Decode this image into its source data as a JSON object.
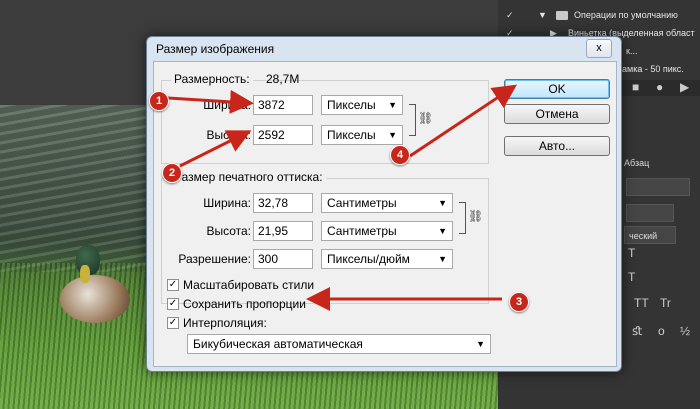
{
  "dialog": {
    "title": "Размер изображения",
    "close_label": "x",
    "pixel_dims": {
      "legend_label": "Размерность:",
      "size_value": "28,7M",
      "width_label": "Ширина:",
      "width_value": "3872",
      "width_unit": "Пикселы",
      "height_label": "Высота:",
      "height_value": "2592",
      "height_unit": "Пикселы"
    },
    "print_size": {
      "legend_label": "Размер печатного оттиска:",
      "width_label": "Ширина:",
      "width_value": "32,78",
      "width_unit": "Сантиметры",
      "height_label": "Высота:",
      "height_value": "21,95",
      "height_unit": "Сантиметры",
      "resolution_label": "Разрешение:",
      "resolution_value": "300",
      "resolution_unit": "Пикселы/дюйм"
    },
    "buttons": {
      "ok": "OK",
      "cancel": "Отмена",
      "auto": "Авто..."
    },
    "checkboxes": [
      {
        "label": "Масштабировать стили",
        "checked": true
      },
      {
        "label": "Сохранить пропорции",
        "checked": true
      },
      {
        "label": "Интерполяция:",
        "checked": true
      }
    ],
    "checkmark": "✓",
    "interpolation_value": "Бикубическая автоматическая",
    "dropdown_arrow": "▼",
    "chain_icon": "⛓"
  },
  "annotations": {
    "badges": [
      "1",
      "2",
      "3",
      "4"
    ],
    "color": "#c8261b"
  },
  "right_panel": {
    "actions": [
      {
        "label": "Операции по умолчанию"
      },
      {
        "label": "Виньетка (выделенная област"
      },
      {
        "label": "к..."
      },
      {
        "label": "амка - 50 пикс."
      }
    ],
    "tab_label": "Абзац",
    "field_label": "ческий"
  }
}
